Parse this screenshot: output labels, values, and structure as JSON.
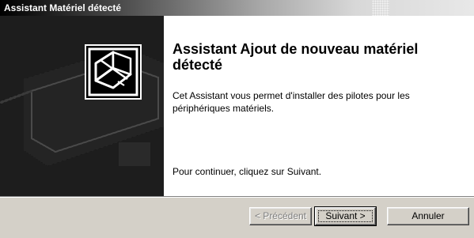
{
  "window": {
    "title": "Assistant Matériel détecté"
  },
  "content": {
    "heading": "Assistant Ajout de nouveau matériel détecté",
    "description": "Cet Assistant vous permet d'installer des pilotes pour les périphériques matériels.",
    "instruction": "Pour continuer, cliquez sur Suivant."
  },
  "buttons": {
    "previous": {
      "label": "< Précédent",
      "enabled": false
    },
    "next": {
      "label": "Suivant >",
      "enabled": true,
      "default": true
    },
    "cancel": {
      "label": "Annuler",
      "enabled": true
    }
  },
  "icons": {
    "wizard_graphic": "hardware-box-icon"
  },
  "colors": {
    "title_gradient_start": "#000000",
    "title_gradient_end": "#e8e8e8",
    "panel_background": "#000000",
    "content_background": "#ffffff",
    "dialog_face": "#d4d0c8"
  }
}
